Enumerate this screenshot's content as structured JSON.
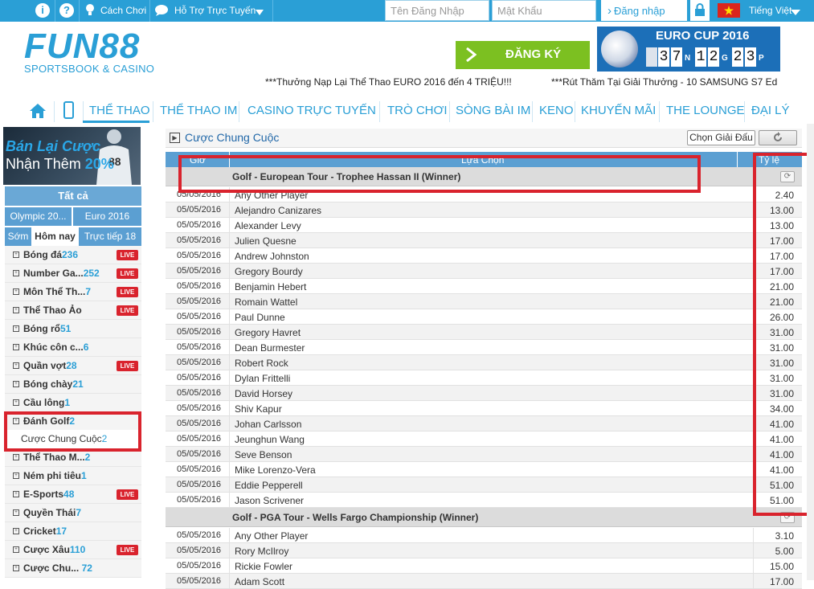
{
  "topbar": {
    "how_to_play": "Cách Chơi",
    "support": "Hỗ Trợ Trực Tuyến",
    "username_placeholder": "Tên Đăng Nhập",
    "password_placeholder": "Mật Khẩu",
    "login": "Đăng nhập",
    "language": "Tiếng Việt",
    "info_icon": "i",
    "help_icon": "?"
  },
  "header": {
    "logo_main": "FUN88",
    "logo_sub": "SPORTSBOOK & CASINO",
    "register": "ĐĂNG KÝ",
    "euro_title": "EURO CUP 2016",
    "countdown": {
      "days": [
        "3",
        "7"
      ],
      "days_unit": "N",
      "hours": [
        "1",
        "2"
      ],
      "hours_unit": "G",
      "minutes": [
        "2",
        "3"
      ],
      "minutes_unit": "P"
    },
    "promo_1": "***Thưởng Nạp Lại Thể Thao EURO 2016 đến 4 TRIỆU!!!",
    "promo_2": "***Rút Thăm Tại Giải Thưởng - 10 SAMSUNG S7 Ed"
  },
  "nav": {
    "items": [
      "THỂ THAO",
      "THỂ THAO IM",
      "CASINO TRỰC TUYẾN",
      "TRÒ CHƠI",
      "SÒNG BÀI IM",
      "KENO",
      "KHUYẾN MÃI",
      "THE LOUNGE",
      "ĐẠI LÝ"
    ]
  },
  "sidebar": {
    "banner_line1": "Bán Lại Cược",
    "banner_line2": "Nhận Thêm",
    "banner_pct": "20%",
    "all": "Tất cả",
    "tabs_top": [
      "Olympic 20...",
      "Euro 2016"
    ],
    "tabs_time": [
      "Sớm",
      "Hôm nay",
      "Trực tiếp 18"
    ],
    "live_badge": "LIVE",
    "sports": [
      {
        "name": "Bóng đá",
        "count": "236",
        "live": true
      },
      {
        "name": "Number Ga...",
        "count": "252",
        "live": true
      },
      {
        "name": "Môn Thể Th...",
        "count": "7",
        "live": true
      },
      {
        "name": "Thể Thao Ảo",
        "count": "",
        "live": true
      },
      {
        "name": "Bóng rổ",
        "count": "51",
        "live": false
      },
      {
        "name": "Khúc côn c...",
        "count": "6",
        "live": false
      },
      {
        "name": "Quần vợt",
        "count": "28",
        "live": true
      },
      {
        "name": "Bóng chày",
        "count": "21",
        "live": false
      },
      {
        "name": "Cầu lông",
        "count": "1",
        "live": false
      },
      {
        "name": "Đánh Golf",
        "count": "2",
        "live": false
      }
    ],
    "sub_item": {
      "name": "Cược Chung Cuộc",
      "count": "2"
    },
    "sports_after": [
      {
        "name": "Thể Thao M...",
        "count": "2",
        "live": false
      },
      {
        "name": "Ném phi tiêu",
        "count": "1",
        "live": false
      },
      {
        "name": "E-Sports",
        "count": "48",
        "live": true
      },
      {
        "name": "Quyền Thái",
        "count": "7",
        "live": false
      },
      {
        "name": "Cricket",
        "count": "17",
        "live": false
      },
      {
        "name": "Cược Xâu",
        "count": "110",
        "live": true
      },
      {
        "name": "Cược Chu...",
        "count": "72",
        "live": false
      }
    ]
  },
  "main": {
    "title": "Cược Chung Cuộc",
    "choose_league": "Chọn Giải Đấu",
    "col_time": "Giờ",
    "col_selection": "Lựa Chọn",
    "col_odds": "Tỷ lệ",
    "groups": [
      {
        "name": "Golf - European Tour - Trophee Hassan II (Winner)",
        "rows": [
          {
            "date": "05/05/2016",
            "player": "Any Other Player",
            "odds": "2.40"
          },
          {
            "date": "05/05/2016",
            "player": "Alejandro Canizares",
            "odds": "13.00"
          },
          {
            "date": "05/05/2016",
            "player": "Alexander Levy",
            "odds": "13.00"
          },
          {
            "date": "05/05/2016",
            "player": "Julien Quesne",
            "odds": "17.00"
          },
          {
            "date": "05/05/2016",
            "player": "Andrew Johnston",
            "odds": "17.00"
          },
          {
            "date": "05/05/2016",
            "player": "Gregory Bourdy",
            "odds": "17.00"
          },
          {
            "date": "05/05/2016",
            "player": "Benjamin Hebert",
            "odds": "21.00"
          },
          {
            "date": "05/05/2016",
            "player": "Romain Wattel",
            "odds": "21.00"
          },
          {
            "date": "05/05/2016",
            "player": "Paul Dunne",
            "odds": "26.00"
          },
          {
            "date": "05/05/2016",
            "player": "Gregory Havret",
            "odds": "31.00"
          },
          {
            "date": "05/05/2016",
            "player": "Dean Burmester",
            "odds": "31.00"
          },
          {
            "date": "05/05/2016",
            "player": "Robert Rock",
            "odds": "31.00"
          },
          {
            "date": "05/05/2016",
            "player": "Dylan Frittelli",
            "odds": "31.00"
          },
          {
            "date": "05/05/2016",
            "player": "David Horsey",
            "odds": "31.00"
          },
          {
            "date": "05/05/2016",
            "player": "Shiv Kapur",
            "odds": "34.00"
          },
          {
            "date": "05/05/2016",
            "player": "Johan Carlsson",
            "odds": "41.00"
          },
          {
            "date": "05/05/2016",
            "player": "Jeunghun Wang",
            "odds": "41.00"
          },
          {
            "date": "05/05/2016",
            "player": "Seve Benson",
            "odds": "41.00"
          },
          {
            "date": "05/05/2016",
            "player": "Mike Lorenzo-Vera",
            "odds": "41.00"
          },
          {
            "date": "05/05/2016",
            "player": "Eddie Pepperell",
            "odds": "51.00"
          },
          {
            "date": "05/05/2016",
            "player": "Jason Scrivener",
            "odds": "51.00"
          }
        ]
      },
      {
        "name": "Golf - PGA Tour - Wells Fargo Championship (Winner)",
        "rows": [
          {
            "date": "05/05/2016",
            "player": "Any Other Player",
            "odds": "3.10"
          },
          {
            "date": "05/05/2016",
            "player": "Rory McIlroy",
            "odds": "5.00"
          },
          {
            "date": "05/05/2016",
            "player": "Rickie Fowler",
            "odds": "15.00"
          },
          {
            "date": "05/05/2016",
            "player": "Adam Scott",
            "odds": "17.00"
          }
        ]
      }
    ]
  },
  "colors": {
    "brand_blue": "#2a9fd6",
    "register_green": "#7cc021",
    "live_red": "#d9232d",
    "annotation_red": "#d9232d"
  }
}
